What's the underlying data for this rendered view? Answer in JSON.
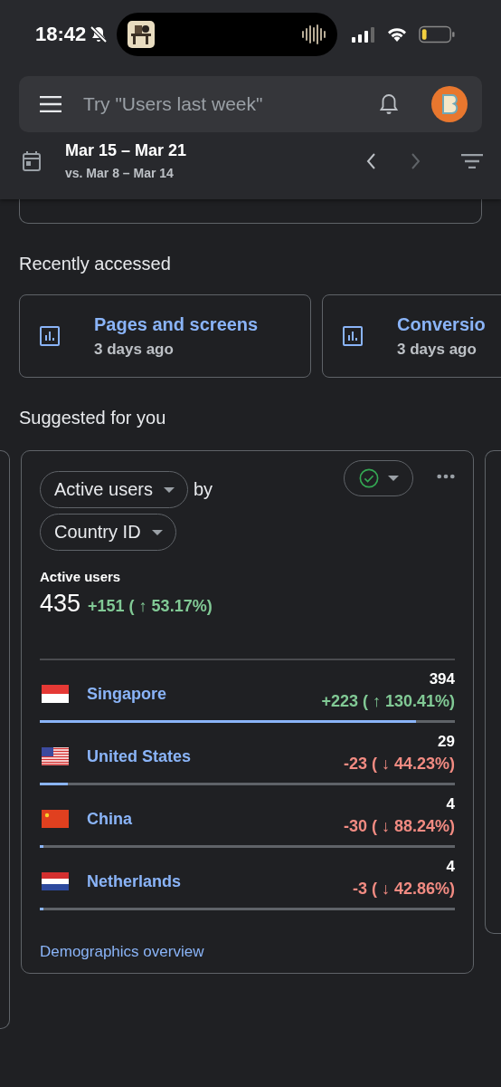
{
  "status_bar": {
    "time": "18:42"
  },
  "search": {
    "placeholder": "Try \"Users last week\""
  },
  "date_range": {
    "current": "Mar 15 – Mar 21",
    "comparison": "vs. Mar 8 – Mar 14",
    "next_disabled": true
  },
  "recently_accessed": {
    "title": "Recently accessed",
    "items": [
      {
        "name": "Pages and screens",
        "time": "3 days ago"
      },
      {
        "name": "Conversio",
        "time": "3 days ago"
      }
    ]
  },
  "suggested": {
    "title": "Suggested for you",
    "card": {
      "metric": "Active users",
      "by": "by",
      "dimension": "Country ID",
      "summary_label": "Active users",
      "total": "435",
      "change": "+151 ( ↑ 53.17%)",
      "kind": "increase",
      "rows": [
        {
          "name": "Singapore",
          "value": "394",
          "change": "+223 ( ↑ 130.41%)",
          "kind": "increase",
          "level": 0.906
        },
        {
          "name": "United States",
          "value": "29",
          "change": "-23 ( ↓ 44.23%)",
          "kind": "decrease",
          "level": 0.067
        },
        {
          "name": "China",
          "value": "4",
          "change": "-30 ( ↓ 88.24%)",
          "kind": "decrease",
          "level": 0.009
        },
        {
          "name": "Netherlands",
          "value": "4",
          "change": "-3 ( ↓ 42.86%)",
          "kind": "decrease",
          "level": 0.009
        }
      ],
      "link": "Demographics overview"
    }
  }
}
